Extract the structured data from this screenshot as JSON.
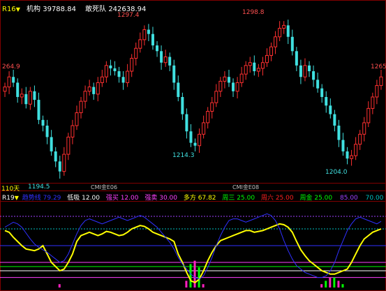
{
  "top_panel": {
    "tag": "R16",
    "tag_color": "#ffff00",
    "fields": [
      {
        "label": "机构",
        "value": "39788.84",
        "color": "#ffffff"
      },
      {
        "label": "敢死队",
        "value": "242638.94",
        "color": "#ffffff"
      }
    ],
    "labels": {
      "high1": "1297.4",
      "high2": "1298.8",
      "left_mid": "264.9",
      "right_mid": "1265",
      "low1": "1214.3",
      "low2": "1204.0",
      "low_left": "1194.5"
    },
    "axis_bar": {
      "period": "110天",
      "marker1": "CMI金E06",
      "marker2": "CMI金E08"
    }
  },
  "bottom_panel": {
    "tag": "R19",
    "legend": [
      {
        "label": "趋势线",
        "value": "79.29",
        "color": "#3030ff"
      },
      {
        "label": "低吸",
        "value": "12.00",
        "color": "#ffffff"
      },
      {
        "label": "强买",
        "value": "12.00",
        "color": "#ff40ff"
      },
      {
        "label": "强卖",
        "value": "30.00",
        "color": "#ff40ff"
      },
      {
        "label": "多方",
        "value": "67.82",
        "color": "#ffff00"
      },
      {
        "label": "周三",
        "value": "25.00",
        "color": "#00ff00"
      },
      {
        "label": "周六",
        "value": "25.00",
        "color": "#ff2020"
      },
      {
        "label": "周金",
        "value": "25.00",
        "color": "#00ff00"
      },
      {
        "label": "",
        "value": "85.00",
        "color": "#a040ff"
      },
      {
        "label": "",
        "value": "70.00",
        "color": "#00c0c0"
      }
    ]
  },
  "chart_data": [
    {
      "type": "candlestick",
      "title": "",
      "annotations": [
        "1297.4",
        "1298.8",
        "264.9",
        "1265",
        "1214.3",
        "1204.0",
        "1194.5"
      ],
      "ylim": [
        1190,
        1305
      ],
      "series": [
        {
          "name": "price",
          "values": [
            1255,
            1262,
            1258,
            1248,
            1250,
            1243,
            1252,
            1246,
            1232,
            1228,
            1220,
            1210,
            1203,
            1196,
            1208,
            1220,
            1228,
            1237,
            1245,
            1252,
            1255,
            1250,
            1258,
            1262,
            1270,
            1268,
            1266,
            1262,
            1258,
            1266,
            1275,
            1282,
            1288,
            1295,
            1292,
            1284,
            1280,
            1272,
            1276,
            1270,
            1258,
            1248,
            1236,
            1224,
            1216,
            1214,
            1222,
            1230,
            1238,
            1244,
            1252,
            1259,
            1262,
            1258,
            1252,
            1258,
            1264,
            1270,
            1272,
            1266,
            1268,
            1272,
            1277,
            1283,
            1290,
            1296,
            1298,
            1290,
            1280,
            1270,
            1262,
            1270,
            1266,
            1260,
            1254,
            1248,
            1242,
            1236,
            1228,
            1218,
            1210,
            1205,
            1207,
            1215,
            1222,
            1230,
            1240,
            1248,
            1256,
            1262
          ]
        }
      ]
    },
    {
      "type": "line",
      "title": "",
      "ylim": [
        0,
        100
      ],
      "series": [
        {
          "name": "多方",
          "color": "#ffff00",
          "values": [
            68,
            66,
            60,
            55,
            50,
            46,
            45,
            44,
            46,
            50,
            40,
            30,
            25,
            20,
            22,
            30,
            40,
            55,
            62,
            64,
            66,
            64,
            62,
            64,
            67,
            66,
            64,
            62,
            63,
            66,
            70,
            72,
            74,
            73,
            70,
            66,
            64,
            62,
            60,
            58,
            55,
            40,
            30,
            18,
            8,
            6,
            10,
            20,
            32,
            42,
            50,
            56,
            58,
            60,
            62,
            64,
            66,
            68,
            68,
            66,
            67,
            68,
            70,
            72,
            74,
            76,
            75,
            72,
            66,
            55,
            45,
            38,
            32,
            28,
            24,
            20,
            18,
            16,
            16,
            18,
            20,
            22,
            30,
            40,
            50,
            58,
            62,
            66,
            68,
            70
          ]
        },
        {
          "name": "趋势线",
          "color": "#3030ff",
          "values": [
            72,
            75,
            78,
            76,
            72,
            65,
            58,
            52,
            48,
            45,
            42,
            38,
            34,
            30,
            32,
            40,
            52,
            64,
            74,
            80,
            82,
            80,
            78,
            76,
            78,
            80,
            82,
            84,
            82,
            80,
            82,
            84,
            86,
            84,
            80,
            76,
            72,
            66,
            60,
            54,
            46,
            36,
            28,
            22,
            16,
            12,
            10,
            14,
            24,
            36,
            50,
            62,
            72,
            80,
            82,
            82,
            80,
            78,
            80,
            82,
            84,
            86,
            88,
            86,
            80,
            70,
            56,
            44,
            34,
            26,
            22,
            18,
            16,
            14,
            12,
            12,
            14,
            20,
            30,
            44,
            56,
            68,
            76,
            82,
            84,
            82,
            80,
            78,
            76,
            79
          ]
        }
      ]
    }
  ]
}
